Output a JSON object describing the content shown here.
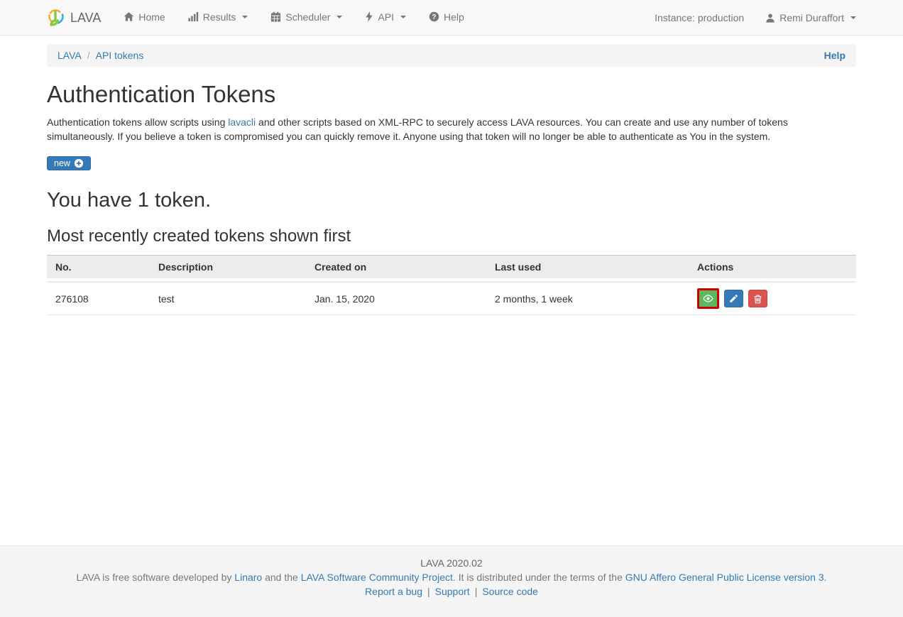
{
  "navbar": {
    "brand": "LAVA",
    "items": [
      {
        "label": "Home",
        "icon": "home-icon",
        "has_caret": false
      },
      {
        "label": "Results",
        "icon": "bar-chart-icon",
        "has_caret": true
      },
      {
        "label": "Scheduler",
        "icon": "calendar-icon",
        "has_caret": true
      },
      {
        "label": "API",
        "icon": "bolt-icon",
        "has_caret": true
      },
      {
        "label": "Help",
        "icon": "question-circle-icon",
        "has_caret": false
      }
    ],
    "instance_label": "Instance: production",
    "user": {
      "name": "Remi Duraffort",
      "icon": "user-icon"
    }
  },
  "breadcrumb": {
    "items": [
      "LAVA",
      "API tokens"
    ],
    "separator": "/",
    "help_label": "Help"
  },
  "content": {
    "title": "Authentication Tokens",
    "intro": {
      "text_before_link": "Authentication tokens allow scripts using ",
      "link_label": "lavacli",
      "text_after_link": " and other scripts based on XML-RPC to securely access LAVA resources. You can create and use any number of tokens simultaneously. If you believe a token is compromised you can quickly remove it. Anyone using that token will no longer be able to authenticate as You in the system."
    },
    "new_button": {
      "label": "new",
      "icon": "plus-circle-icon"
    },
    "token_count_heading": "You have 1 token.",
    "tokens_subheading": "Most recently created tokens shown first"
  },
  "table": {
    "columns": [
      "No.",
      "Description",
      "Created on",
      "Last used",
      "Actions"
    ],
    "rows": [
      {
        "no": "276108",
        "description": "test",
        "created_on": "Jan. 15, 2020",
        "last_used": "2 months, 1 week",
        "actions": [
          {
            "name": "view",
            "icon": "eye-icon"
          },
          {
            "name": "edit",
            "icon": "pencil-icon"
          },
          {
            "name": "delete",
            "icon": "trash-icon"
          }
        ]
      }
    ]
  },
  "footer": {
    "version_line": "LAVA 2020.02",
    "license_line": {
      "part1": "LAVA is free software developed by ",
      "link1": "Linaro",
      "part2": " and the ",
      "link2": "LAVA Software Community Project",
      "part3": ". It is distributed under the terms of the ",
      "link3": "GNU Affero General Public License version 3",
      "part4": "."
    },
    "links_line": {
      "link1": "Report a bug",
      "separator": "|",
      "link2": "Support",
      "link3": "Source code"
    }
  },
  "colors": {
    "primary": "#337ab7",
    "success": "#5cb85c",
    "danger": "#d9534f",
    "navbar_bg": "#f8f8f8",
    "breadcrumb_bg": "#f5f5f5",
    "table_header_bg": "#ececec",
    "footer_bg": "#f5f5f5",
    "eye_button_outline": "#cc0000",
    "logo_green": "#8dc63f",
    "logo_orange": "#f5a91f",
    "logo_blue": "#29aae2",
    "text_muted": "#777777",
    "text_body": "#333333"
  }
}
